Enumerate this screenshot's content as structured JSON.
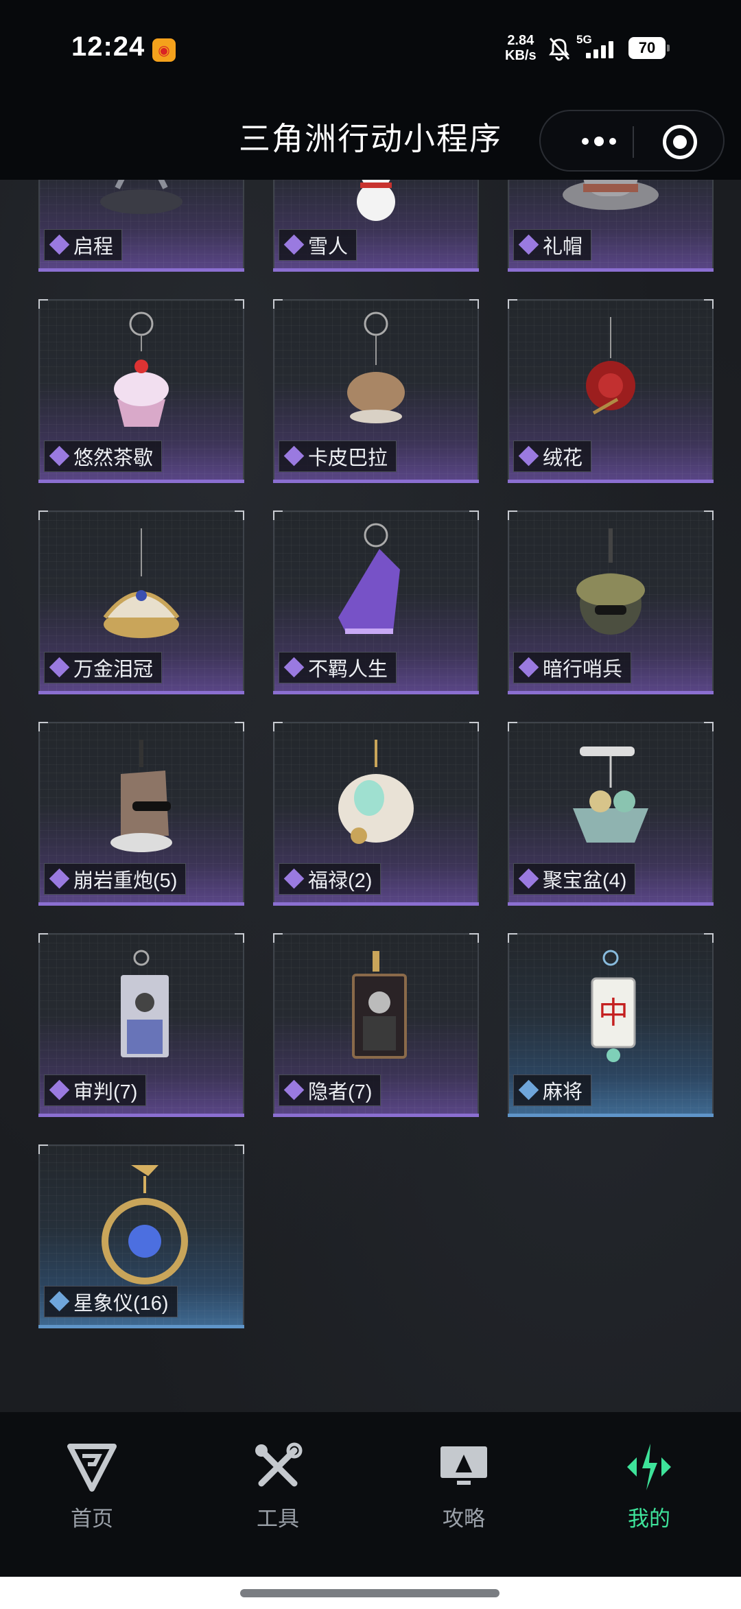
{
  "status_bar": {
    "time": "12:24",
    "speed_value": "2.84",
    "speed_unit": "KB/s",
    "network": "5G",
    "battery": "70"
  },
  "header": {
    "title": "三角洲行动小程序"
  },
  "colors": {
    "purple_rarity": "#8b6fd1",
    "blue_rarity": "#5f95c9",
    "active_tab": "#3ee39a"
  },
  "items": [
    {
      "label": "启程",
      "rarity": "purple",
      "icon": "delta-force-logo-icon"
    },
    {
      "label": "雪人",
      "rarity": "purple",
      "icon": "snowman-pendant-icon"
    },
    {
      "label": "礼帽",
      "rarity": "purple",
      "icon": "top-hat-pendant-icon"
    },
    {
      "label": "悠然茶歇",
      "rarity": "purple",
      "icon": "cupcake-pendant-icon"
    },
    {
      "label": "卡皮巴拉",
      "rarity": "purple",
      "icon": "capybara-pendant-icon"
    },
    {
      "label": "绒花",
      "rarity": "purple",
      "icon": "rose-pendant-icon"
    },
    {
      "label": "万金泪冠",
      "rarity": "purple",
      "icon": "jewel-box-pendant-icon"
    },
    {
      "label": "不羁人生",
      "rarity": "purple",
      "icon": "sneaker-pendant-icon"
    },
    {
      "label": "暗行哨兵",
      "rarity": "purple",
      "icon": "sentry-pendant-icon"
    },
    {
      "label": "崩岩重炮(5)",
      "rarity": "purple",
      "icon": "rock-figure-pendant-icon"
    },
    {
      "label": "福禄(2)",
      "rarity": "purple",
      "icon": "gourd-figure-pendant-icon"
    },
    {
      "label": "聚宝盆(4)",
      "rarity": "purple",
      "icon": "treasure-bowl-pendant-icon"
    },
    {
      "label": "审判(7)",
      "rarity": "purple",
      "icon": "judgement-card-pendant-icon"
    },
    {
      "label": "隐者(7)",
      "rarity": "purple",
      "icon": "hermit-card-pendant-icon"
    },
    {
      "label": "麻将",
      "rarity": "blue",
      "icon": "mahjong-tile-pendant-icon"
    },
    {
      "label": "星象仪(16)",
      "rarity": "blue",
      "icon": "armillary-pendant-icon"
    }
  ],
  "nav": [
    {
      "label": "首页",
      "icon": "delta-home-icon",
      "active": false
    },
    {
      "label": "工具",
      "icon": "tools-icon",
      "active": false
    },
    {
      "label": "攻略",
      "icon": "guide-monitor-icon",
      "active": false
    },
    {
      "label": "我的",
      "icon": "profile-logo-icon",
      "active": true
    }
  ]
}
